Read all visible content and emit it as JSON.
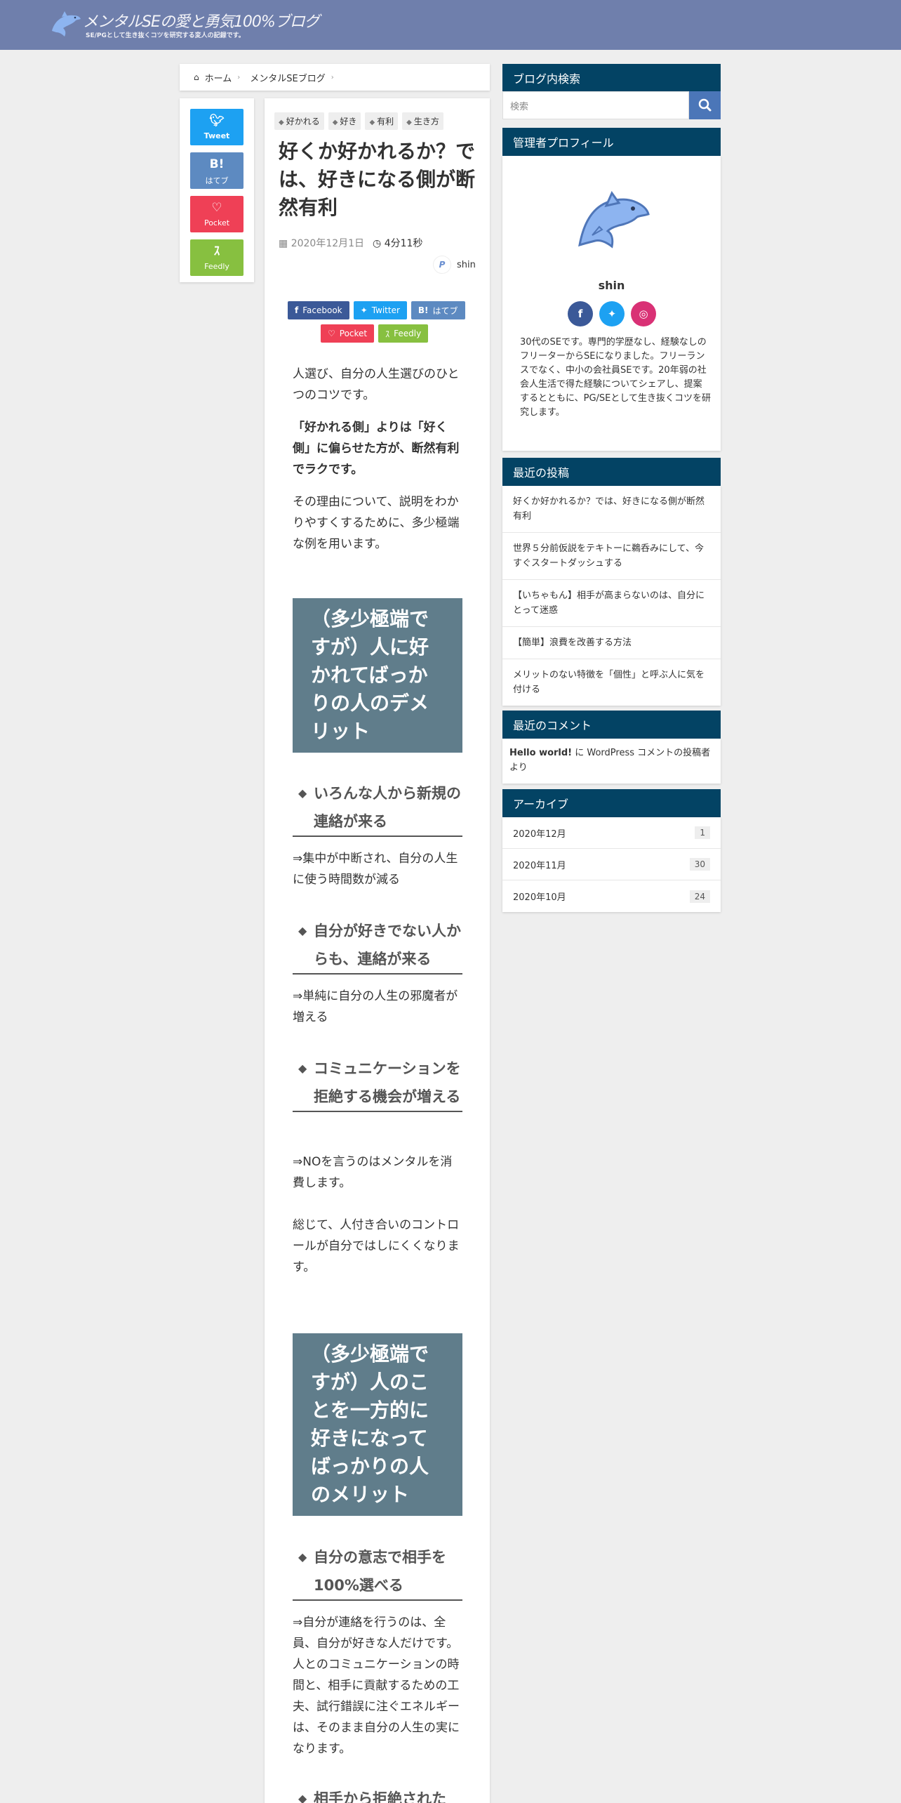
{
  "header": {
    "site_title": "メンタルSEの愛と勇気100%ブログ",
    "tagline": "SE/PGとして生き抜くコツを研究する変人の記録です。"
  },
  "breadcrumb": {
    "home": "ホーム",
    "category": "メンタルSEブログ"
  },
  "share_side": {
    "tweet": "Tweet",
    "hatena_glyph": "B!",
    "hatena": "はてブ",
    "pocket": "Pocket",
    "feedly": "Feedly"
  },
  "article": {
    "tags": [
      "好かれる",
      "好き",
      "有利",
      "生き方"
    ],
    "title": "好くか好かれるか？では、好きになる側が断然有利",
    "date": "2020年12月1日",
    "read_time": "4分11秒",
    "author": "shin",
    "share_buttons": {
      "facebook": "Facebook",
      "twitter": "Twitter",
      "hatena": "はてブ",
      "pocket": "Pocket",
      "feedly": "Feedly"
    },
    "p1": "人選び、自分の人生選びのひとつのコツです。",
    "p2": "「好かれる側」よりは「好く側」に偏らせた方が、断然有利でラクです。",
    "p3": "その理由について、説明をわかりやすくするために、多少極端な例を用います。",
    "h2_1": "（多少極端ですが）人に好かれてばっかりの人のデメリット",
    "h3_1": "いろんな人から新規の連絡が来る",
    "p4": "⇒集中が中断され、自分の人生に使う時間数が減る",
    "h3_2": "自分が好きでない人からも、連絡が来る",
    "p5": "⇒単純に自分の人生の邪魔者が増える",
    "h3_3": "コミュニケーションを拒絶する機会が増える",
    "p6": "⇒NOを言うのはメンタルを消費します。",
    "p7": "総じて、人付き合いのコントロールが自分ではしにくくなります。",
    "h2_2": "（多少極端ですが）人のことを一方的に好きになってばっかりの人のメリット",
    "h3_4": "自分の意志で相手を100%選べる",
    "p8": "⇒自分が連絡を行うのは、全員、自分が好きな人だけです。人とのコミュニケーションの時間と、相手に貢献するための工夫、試行錯誤に注ぐエネルギーは、そのまま自分の人生の実になります。",
    "h3_5": "相手から拒絶された"
  },
  "sidebar": {
    "search_title": "ブログ内検索",
    "search_placeholder": "検索",
    "profile_title": "管理者プロフィール",
    "profile_name": "shin",
    "profile_desc": "30代のSEです。専門的学歴なし、経験なしのフリーターからSEになりました。フリーランスでなく、中小の会社員SEです。20年弱の社会人生活で得た経験についてシェアし、提案するとともに、PG/SEとして生き抜くコツを研究します。",
    "recent_posts_title": "最近の投稿",
    "recent_posts": [
      "好くか好かれるか？では、好きになる側が断然有利",
      "世界５分前仮説をテキトーに鵜呑みにして、今すぐスタートダッシュする",
      "【いちゃもん】相手が高まらないのは、自分にとって迷惑",
      "【簡単】浪費を改善する方法",
      "メリットのない特徴を「個性」と呼ぶ人に気を付ける"
    ],
    "recent_comments_title": "最近のコメント",
    "comment_post": "Hello world!",
    "comment_text": " に WordPress コメントの投稿者 より",
    "archives_title": "アーカイブ",
    "archives": [
      {
        "month": "2020年12月",
        "count": "1"
      },
      {
        "month": "2020年11月",
        "count": "30"
      },
      {
        "month": "2020年10月",
        "count": "24"
      }
    ]
  },
  "colors": {
    "header": "#6f7fac",
    "widget_head": "#034364",
    "h2_bg": "#607d8b",
    "facebook": "#3b5998",
    "twitter": "#1da1f2",
    "hatena": "#5d8ac1",
    "pocket": "#ef4056",
    "feedly": "#87c040",
    "instagram": "#d93175"
  }
}
